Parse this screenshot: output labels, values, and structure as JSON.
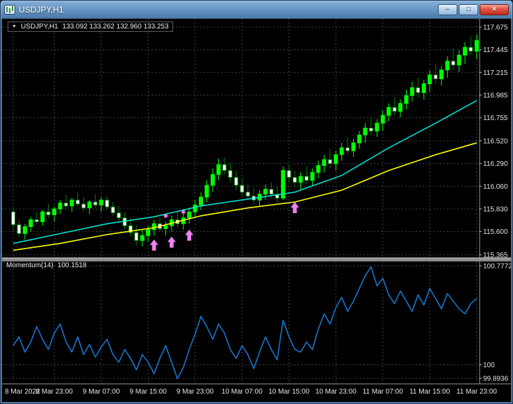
{
  "window": {
    "title": "USDJPY,H1",
    "buttons": {
      "minimize": "–",
      "maximize": "□",
      "close": "×"
    }
  },
  "chart": {
    "caret": "▼",
    "symbol": "USDJPY,H1",
    "ohlc": "133.092 133.262 132.960 133.253"
  },
  "chart_data": {
    "type": "candlestick",
    "title": "USDJPY,H1",
    "timeframe": "H1",
    "colors": {
      "background": "#000000",
      "grid": "#3A4550",
      "bar_up": "#00FF00",
      "bar_down": "#008000",
      "bull_body": "#00FF00",
      "bear_body": "#FFFFFF",
      "ma_fast": "#00E0D0",
      "ma_slow": "#FFFF00",
      "momentum": "#1874CD",
      "signal": "#EE82EE",
      "axis_text": "#E6E6E6"
    },
    "main": {
      "ylim": [
        115.365,
        117.675
      ],
      "price_ticks": [
        "117.675",
        "117.445",
        "117.215",
        "116.985",
        "116.755",
        "116.520",
        "116.290",
        "116.060",
        "115.830",
        "115.600",
        "115.365"
      ],
      "candles_ohlc": [
        [
          115.8,
          115.85,
          115.6,
          115.67
        ],
        [
          115.67,
          115.72,
          115.55,
          115.58
        ],
        [
          115.58,
          115.68,
          115.52,
          115.65
        ],
        [
          115.65,
          115.75,
          115.6,
          115.72
        ],
        [
          115.72,
          115.8,
          115.68,
          115.7
        ],
        [
          115.7,
          115.82,
          115.66,
          115.8
        ],
        [
          115.8,
          115.88,
          115.74,
          115.77
        ],
        [
          115.77,
          115.85,
          115.7,
          115.83
        ],
        [
          115.83,
          115.92,
          115.78,
          115.89
        ],
        [
          115.89,
          115.97,
          115.83,
          115.86
        ],
        [
          115.86,
          115.94,
          115.8,
          115.92
        ],
        [
          115.92,
          116.0,
          115.86,
          115.88
        ],
        [
          115.88,
          115.95,
          115.8,
          115.84
        ],
        [
          115.84,
          115.92,
          115.78,
          115.9
        ],
        [
          115.9,
          115.98,
          115.84,
          115.87
        ],
        [
          115.87,
          115.95,
          115.8,
          115.92
        ],
        [
          115.92,
          115.96,
          115.82,
          115.85
        ],
        [
          115.85,
          115.9,
          115.76,
          115.79
        ],
        [
          115.79,
          115.86,
          115.7,
          115.74
        ],
        [
          115.74,
          115.8,
          115.62,
          115.66
        ],
        [
          115.66,
          115.74,
          115.55,
          115.59
        ],
        [
          115.59,
          115.66,
          115.46,
          115.51
        ],
        [
          115.51,
          115.62,
          115.45,
          115.56
        ],
        [
          115.56,
          115.66,
          115.5,
          115.62
        ],
        [
          115.62,
          115.72,
          115.56,
          115.68
        ],
        [
          115.68,
          115.74,
          115.6,
          115.63
        ],
        [
          115.63,
          115.7,
          115.56,
          115.66
        ],
        [
          115.66,
          115.76,
          115.6,
          115.72
        ],
        [
          115.72,
          115.8,
          115.64,
          115.68
        ],
        [
          115.68,
          115.78,
          115.62,
          115.74
        ],
        [
          115.74,
          115.84,
          115.68,
          115.8
        ],
        [
          115.8,
          115.92,
          115.74,
          115.87
        ],
        [
          115.87,
          116.0,
          115.82,
          115.95
        ],
        [
          115.95,
          116.12,
          115.9,
          116.07
        ],
        [
          116.07,
          116.24,
          116.0,
          116.18
        ],
        [
          116.18,
          116.34,
          116.12,
          116.28
        ],
        [
          116.28,
          116.35,
          116.18,
          116.22
        ],
        [
          116.22,
          116.3,
          116.1,
          116.15
        ],
        [
          116.15,
          116.22,
          116.02,
          116.07
        ],
        [
          116.07,
          116.14,
          115.96,
          116.0
        ],
        [
          116.0,
          116.08,
          115.92,
          115.96
        ],
        [
          115.96,
          116.04,
          115.88,
          115.92
        ],
        [
          115.92,
          116.02,
          115.86,
          115.98
        ],
        [
          115.98,
          116.08,
          115.92,
          116.03
        ],
        [
          116.03,
          116.1,
          115.94,
          115.98
        ],
        [
          115.98,
          116.06,
          115.9,
          115.94
        ],
        [
          115.94,
          116.26,
          115.92,
          116.22
        ],
        [
          116.22,
          116.28,
          116.1,
          116.15
        ],
        [
          116.15,
          116.22,
          116.05,
          116.1
        ],
        [
          116.1,
          116.2,
          116.02,
          116.16
        ],
        [
          116.16,
          116.26,
          116.08,
          116.12
        ],
        [
          116.12,
          116.24,
          116.06,
          116.2
        ],
        [
          116.2,
          116.32,
          116.14,
          116.27
        ],
        [
          116.27,
          116.38,
          116.2,
          116.33
        ],
        [
          116.33,
          116.44,
          116.24,
          116.29
        ],
        [
          116.29,
          116.42,
          116.22,
          116.38
        ],
        [
          116.38,
          116.5,
          116.32,
          116.45
        ],
        [
          116.45,
          116.56,
          116.38,
          116.42
        ],
        [
          116.42,
          116.54,
          116.36,
          116.5
        ],
        [
          116.5,
          116.62,
          116.44,
          116.58
        ],
        [
          116.58,
          116.7,
          116.5,
          116.65
        ],
        [
          116.65,
          116.76,
          116.58,
          116.62
        ],
        [
          116.62,
          116.74,
          116.56,
          116.7
        ],
        [
          116.7,
          116.83,
          116.62,
          116.78
        ],
        [
          116.78,
          116.9,
          116.72,
          116.86
        ],
        [
          116.86,
          116.96,
          116.78,
          116.82
        ],
        [
          116.82,
          116.94,
          116.76,
          116.9
        ],
        [
          116.9,
          117.04,
          116.84,
          116.98
        ],
        [
          116.98,
          117.12,
          116.92,
          117.06
        ],
        [
          117.06,
          117.16,
          116.96,
          117.01
        ],
        [
          117.01,
          117.14,
          116.94,
          117.1
        ],
        [
          117.1,
          117.24,
          117.02,
          117.19
        ],
        [
          117.19,
          117.3,
          117.1,
          117.15
        ],
        [
          117.15,
          117.28,
          117.08,
          117.24
        ],
        [
          117.24,
          117.38,
          117.16,
          117.33
        ],
        [
          117.33,
          117.46,
          117.24,
          117.29
        ],
        [
          117.29,
          117.44,
          117.22,
          117.39
        ],
        [
          117.39,
          117.52,
          117.3,
          117.47
        ],
        [
          117.47,
          117.58,
          117.39,
          117.43
        ],
        [
          117.43,
          117.6,
          117.35,
          117.54
        ]
      ],
      "ma_fast": {
        "name": "MA fast (cyan)",
        "points": [
          [
            0,
            115.48
          ],
          [
            8,
            115.58
          ],
          [
            16,
            115.68
          ],
          [
            24,
            115.75
          ],
          [
            32,
            115.86
          ],
          [
            40,
            115.93
          ],
          [
            48,
            116.0
          ],
          [
            56,
            116.17
          ],
          [
            64,
            116.45
          ],
          [
            72,
            116.7
          ],
          [
            79,
            116.93
          ]
        ]
      },
      "ma_slow": {
        "name": "MA slow (yellow)",
        "points": [
          [
            0,
            115.41
          ],
          [
            8,
            115.48
          ],
          [
            16,
            115.57
          ],
          [
            24,
            115.64
          ],
          [
            32,
            115.76
          ],
          [
            40,
            115.84
          ],
          [
            48,
            115.9
          ],
          [
            56,
            116.02
          ],
          [
            64,
            116.22
          ],
          [
            72,
            116.38
          ],
          [
            79,
            116.5
          ]
        ]
      },
      "arrows": [
        {
          "i": 24,
          "price": 115.52
        },
        {
          "i": 27,
          "price": 115.55
        },
        {
          "i": 30,
          "price": 115.62
        },
        {
          "i": 48,
          "price": 115.9
        }
      ],
      "stars": [
        {
          "i": 26,
          "price": 115.76
        },
        {
          "i": 29,
          "price": 115.8
        }
      ]
    },
    "momentum": {
      "label": "Momentum(14)",
      "value": "100.1518",
      "ylim": [
        99.8936,
        100.7772
      ],
      "ticks": [
        "100.7772",
        "100",
        "99.8936"
      ],
      "values": [
        100.15,
        100.22,
        100.1,
        100.18,
        100.3,
        100.2,
        100.12,
        100.25,
        100.32,
        100.18,
        100.1,
        100.22,
        100.08,
        100.16,
        100.06,
        100.14,
        100.2,
        100.08,
        100.02,
        100.12,
        100.05,
        99.96,
        100.08,
        100.02,
        99.93,
        100.05,
        100.15,
        100.02,
        99.89,
        99.98,
        100.12,
        100.24,
        100.38,
        100.3,
        100.2,
        100.32,
        100.25,
        100.12,
        100.05,
        100.15,
        100.08,
        99.97,
        100.1,
        100.22,
        100.12,
        100.04,
        100.35,
        100.22,
        100.12,
        100.1,
        100.18,
        100.12,
        100.28,
        100.4,
        100.32,
        100.45,
        100.53,
        100.42,
        100.5,
        100.6,
        100.7,
        100.77,
        100.62,
        100.68,
        100.55,
        100.48,
        100.58,
        100.5,
        100.42,
        100.55,
        100.47,
        100.6,
        100.52,
        100.44,
        100.56,
        100.5,
        100.44,
        100.4,
        100.48,
        100.52
      ]
    },
    "time_ticks": [
      {
        "i": 0,
        "label": "8 Mar 2022"
      },
      {
        "i": 7,
        "label": "8 Mar 23:00"
      },
      {
        "i": 15,
        "label": "9 Mar 07:00"
      },
      {
        "i": 23,
        "label": "9 Mar 15:00"
      },
      {
        "i": 31,
        "label": "9 Mar 23:00"
      },
      {
        "i": 39,
        "label": "10 Mar 07:00"
      },
      {
        "i": 47,
        "label": "10 Mar 15:00"
      },
      {
        "i": 55,
        "label": "10 Mar 23:00"
      },
      {
        "i": 63,
        "label": "11 Mar 07:00"
      },
      {
        "i": 71,
        "label": "11 Mar 15:00"
      },
      {
        "i": 79,
        "label": "11 Mar 23:00"
      }
    ]
  }
}
